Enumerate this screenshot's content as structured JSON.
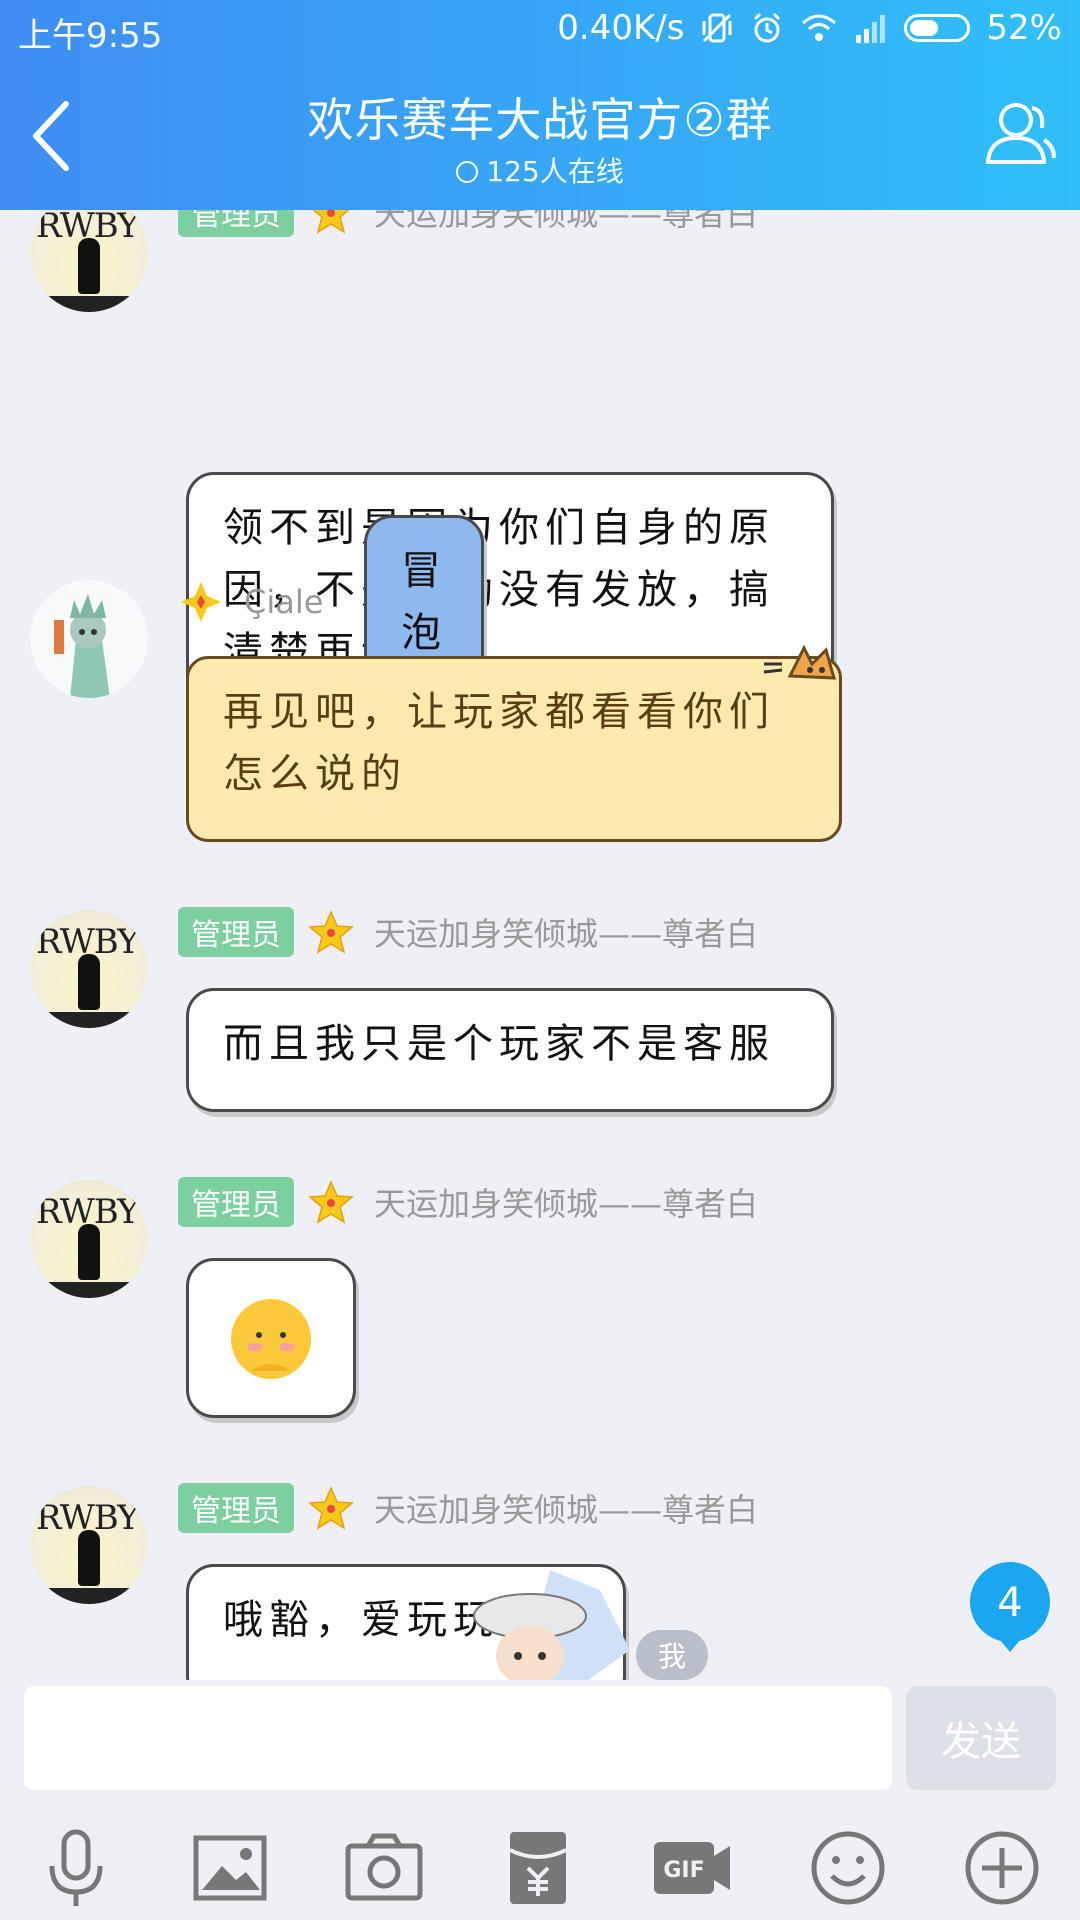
{
  "status_bar": {
    "time": "上午9:55",
    "speed": "0.40K/s",
    "battery": "52%",
    "battery_level": 0.52
  },
  "header": {
    "title": "欢乐赛车大战官方②群",
    "online": "125人在线"
  },
  "messages": [
    {
      "tag": "管理员",
      "nick": "天运加身笑倾城——尊者白",
      "text": "领不到是因为你们自身的原因，不是奖励没有发放，搞清楚再说"
    },
    {
      "tag": "冒泡",
      "nick": "Çiale",
      "text": "再见吧，让玩家都看看你们怎么说的"
    },
    {
      "tag": "管理员",
      "nick": "天运加身笑倾城——尊者白",
      "text": "而且我只是个玩家不是客服"
    },
    {
      "tag": "管理员",
      "nick": "天运加身笑倾城——尊者白",
      "emoji": "emoji-icon"
    },
    {
      "tag": "管理员",
      "nick": "天运加身笑倾城——尊者白",
      "text": "哦豁，爱玩玩"
    }
  ],
  "avatar_text": "RWBY",
  "me_label": "我",
  "unread_count": "4",
  "input": {
    "placeholder": "",
    "send_label": "发送"
  },
  "toolbar": [
    "mic-icon",
    "image-icon",
    "camera-icon",
    "red-packet-icon",
    "gif-icon",
    "emoji-icon",
    "plus-icon"
  ],
  "colors": {
    "header_start": "#3f8ef4",
    "header_end": "#2fc0f8",
    "admin_tag": "#7cd0a0",
    "bubble_tag": "#8fb8ef",
    "unread_badge": "#1aa7ef"
  }
}
